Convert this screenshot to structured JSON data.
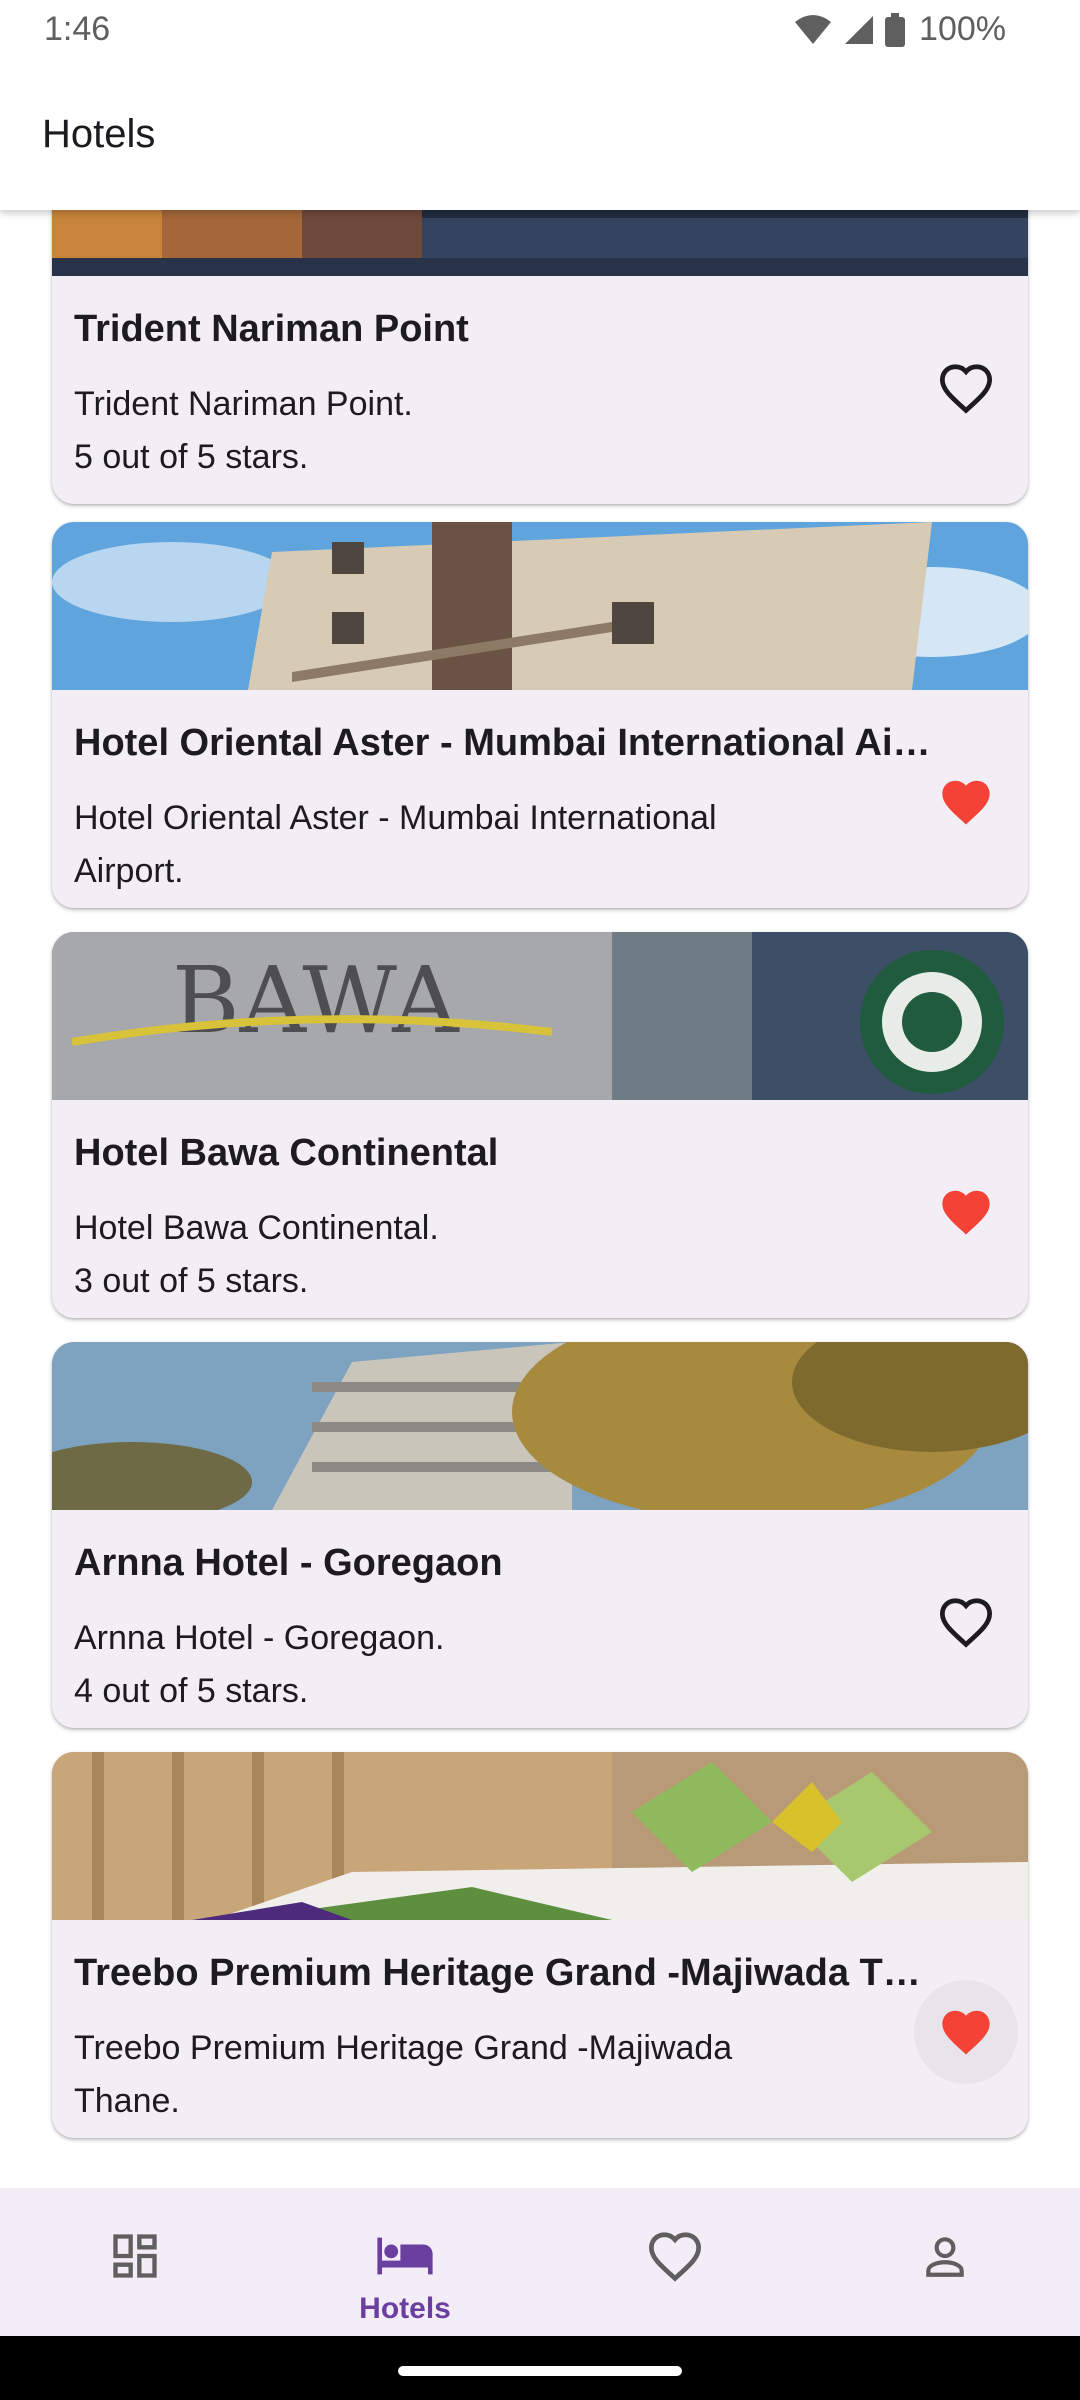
{
  "status_bar": {
    "time": "1:46",
    "battery": "100%"
  },
  "app_bar": {
    "title": "Hotels"
  },
  "hotels": [
    {
      "title": "Trident Nariman Point",
      "line1": "Trident Nariman Point.",
      "line2": "5 out of 5 stars.",
      "favorite": false
    },
    {
      "title": "Hotel Oriental Aster - Mumbai International Airport",
      "line1": "Hotel Oriental Aster - Mumbai International",
      "line2": "Airport.",
      "favorite": true
    },
    {
      "title": "Hotel Bawa Continental",
      "line1": "Hotel Bawa Continental.",
      "line2": "3 out of 5 stars.",
      "favorite": true
    },
    {
      "title": "Arnna Hotel - Goregaon",
      "line1": "Arnna Hotel - Goregaon.",
      "line2": "4 out of 5 stars.",
      "favorite": false
    },
    {
      "title": "Treebo Premium Heritage Grand -Majiwada Thane",
      "line1": "Treebo Premium Heritage Grand -Majiwada",
      "line2": "Thane.",
      "favorite": true
    }
  ],
  "bottom_nav": {
    "items": [
      {
        "icon": "dashboard-icon",
        "label": ""
      },
      {
        "icon": "hotel-bed-icon",
        "label": "Hotels",
        "selected": true
      },
      {
        "icon": "favorite-heart-icon",
        "label": ""
      },
      {
        "icon": "person-icon",
        "label": ""
      }
    ]
  },
  "colors": {
    "card_background": "#f3edf6",
    "favorite_red": "#f44336",
    "nav_selected": "#6a3fa0",
    "nav_background": "#f3edf7",
    "icon_gray": "#5f5f5f"
  }
}
